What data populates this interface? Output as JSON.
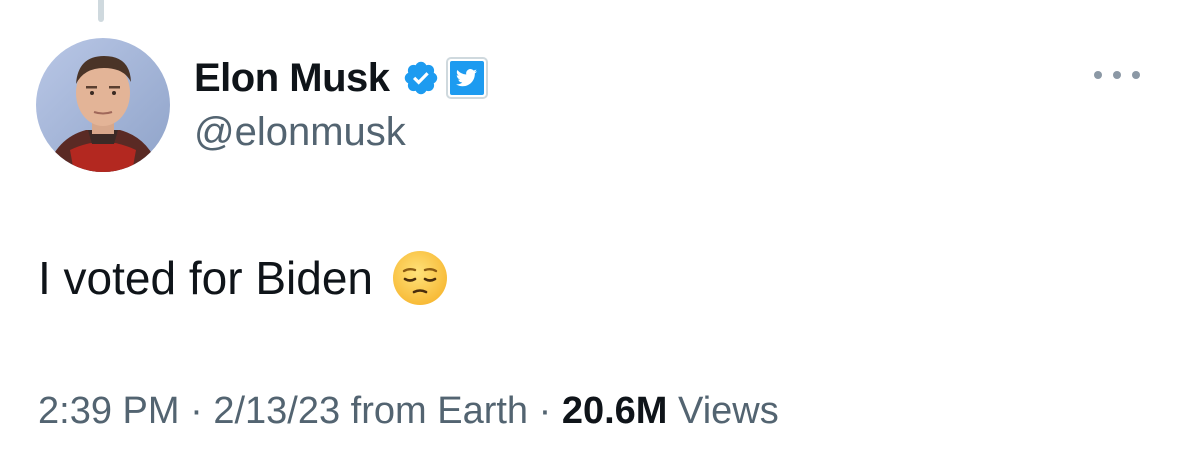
{
  "author": {
    "display_name": "Elon Musk",
    "handle": "@elonmusk",
    "avatar_icon": "profile-photo",
    "verified_icon": "verified-badge-icon",
    "affiliation_icon": "twitter-bird-badge-icon"
  },
  "tweet": {
    "text": "I voted for Biden",
    "emoji_icon": "pensive-face-emoji"
  },
  "meta": {
    "time": "2:39 PM",
    "separator": "·",
    "date": "2/13/23",
    "source": "from Earth",
    "views_count": "20.6M",
    "views_label": "Views"
  },
  "colors": {
    "verified_blue": "#1d9bf0",
    "secondary_text": "#536471",
    "primary_text": "#0f1419"
  }
}
